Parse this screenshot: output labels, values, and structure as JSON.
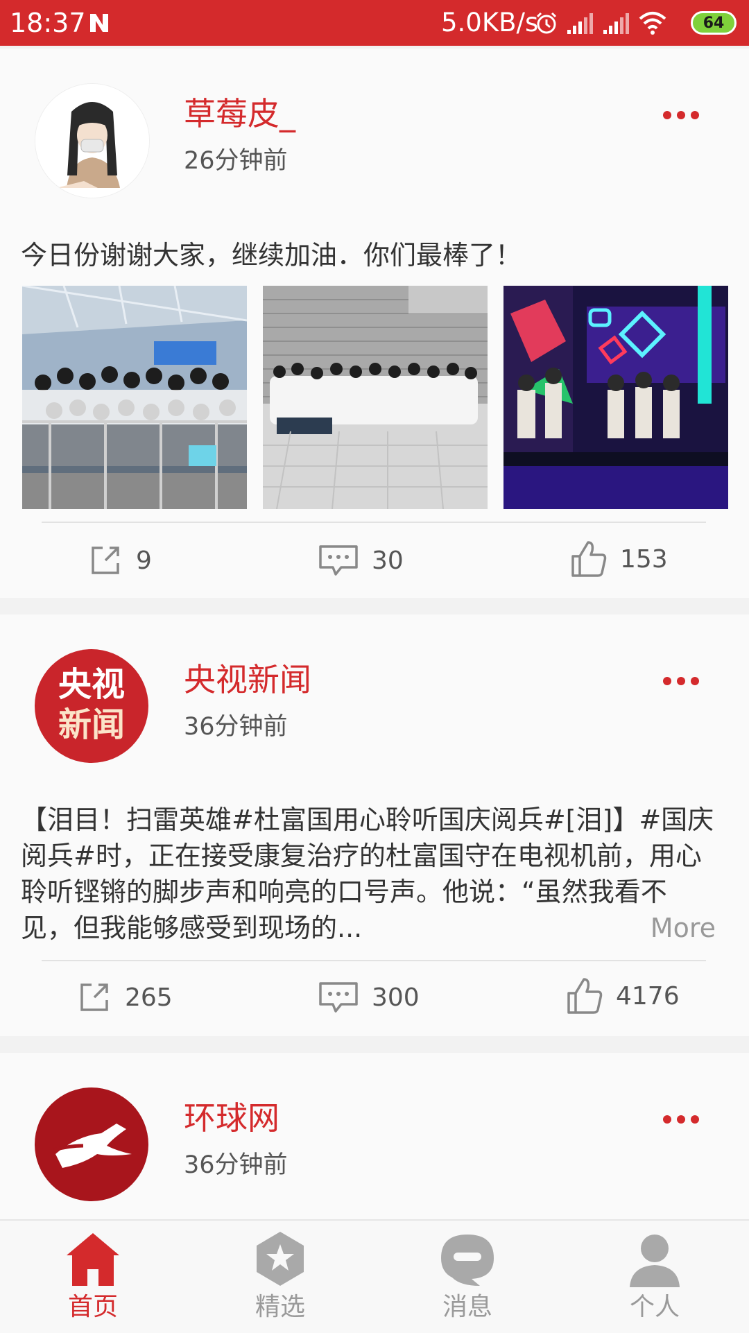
{
  "status_bar": {
    "time": "18:37",
    "network_speed": "5.0KB/s",
    "battery_level": "64"
  },
  "colors": {
    "accent": "#d42a2c",
    "text": "#333333",
    "muted": "#999999",
    "battery": "#7fd13b"
  },
  "posts": [
    {
      "author": "草莓皮_",
      "time": "26分钟前",
      "text": "今日份谢谢大家，继续加油．你们最棒了！",
      "images": [
        "group-photo-indoor",
        "group-photo-outdoor",
        "stage-performance"
      ],
      "shares": "9",
      "comments": "30",
      "likes": "153"
    },
    {
      "author": "央视新闻",
      "avatar_text_line1": "央视",
      "avatar_text_line2": "新闻",
      "time": "36分钟前",
      "text": "【泪目！扫雷英雄#杜富国用心聆听国庆阅兵#[泪]】#国庆阅兵#时，正在接受康复治疗的杜富国守在电视机前，用心聆听铿锵的脚步声和响亮的口号声。他说：“虽然我看不见，但我能够感受到现场的...",
      "more_label": "More",
      "shares": "265",
      "comments": "300",
      "likes": "4176"
    },
    {
      "author": "环球网",
      "time": "36分钟前"
    }
  ],
  "tabs": [
    {
      "label": "首页",
      "icon": "home-icon",
      "active": true
    },
    {
      "label": "精选",
      "icon": "star-icon",
      "active": false
    },
    {
      "label": "消息",
      "icon": "message-icon",
      "active": false
    },
    {
      "label": "个人",
      "icon": "person-icon",
      "active": false
    }
  ]
}
